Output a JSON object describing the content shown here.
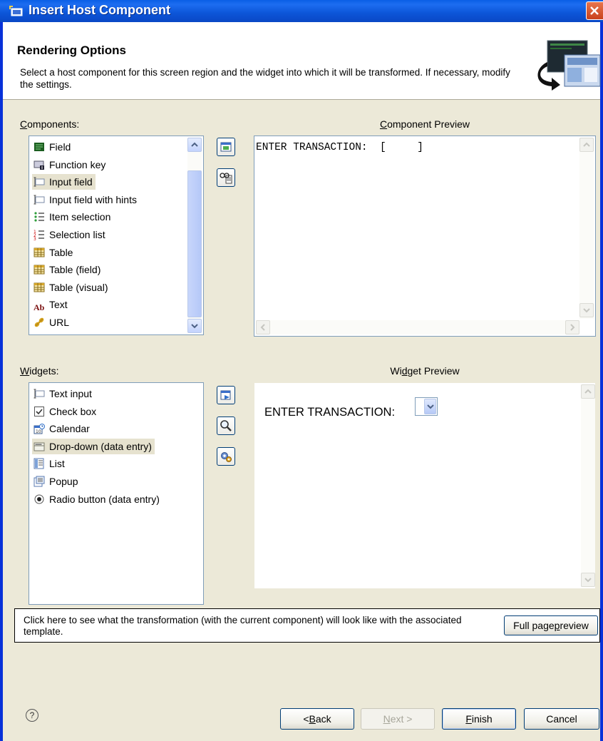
{
  "window": {
    "title": "Insert Host Component",
    "title_icon": "host-component-icon"
  },
  "header": {
    "title": "Rendering Options",
    "description": "Select a host component for this screen region and the widget into which it will be transformed.  If necessary, modify the settings."
  },
  "components": {
    "label_key": "C",
    "label_rest": "omponents:",
    "items": [
      {
        "label": "Field",
        "icon": "field-icon"
      },
      {
        "label": "Function key",
        "icon": "function-key-icon"
      },
      {
        "label": "Input field",
        "icon": "input-field-icon",
        "selected": true
      },
      {
        "label": "Input field with hints",
        "icon": "input-field-hints-icon"
      },
      {
        "label": "Item selection",
        "icon": "item-selection-icon"
      },
      {
        "label": "Selection list",
        "icon": "selection-list-icon"
      },
      {
        "label": "Table",
        "icon": "table-icon"
      },
      {
        "label": "Table (field)",
        "icon": "table-field-icon"
      },
      {
        "label": "Table (visual)",
        "icon": "table-visual-icon"
      },
      {
        "label": "Text",
        "icon": "text-icon"
      },
      {
        "label": "URL",
        "icon": "url-icon"
      }
    ]
  },
  "component_preview": {
    "label_key": "C",
    "label_rest": "omponent Preview",
    "content": "ENTER TRANSACTION:  [     ]"
  },
  "widgets": {
    "label_key": "W",
    "label_rest": "idgets:",
    "items": [
      {
        "label": "Text input",
        "icon": "text-input-icon"
      },
      {
        "label": "Check box",
        "icon": "check-box-icon"
      },
      {
        "label": "Calendar",
        "icon": "calendar-icon"
      },
      {
        "label": "Drop-down (data entry)",
        "icon": "drop-down-icon",
        "selected": true
      },
      {
        "label": "List",
        "icon": "list-icon"
      },
      {
        "label": "Popup",
        "icon": "popup-icon"
      },
      {
        "label": "Radio button (data entry)",
        "icon": "radio-button-icon"
      }
    ]
  },
  "widget_preview": {
    "label_pre": "Wi",
    "label_key": "d",
    "label_rest": "get Preview",
    "field_label": "ENTER TRANSACTION:"
  },
  "info": {
    "text": "Click here to see what the transformation (with the current component) will look like with the associated template.",
    "button_pre": "Full page ",
    "button_key": "p",
    "button_rest": "review"
  },
  "footer": {
    "help": "?",
    "back_pre": "< ",
    "back_key": "B",
    "back_rest": "ack",
    "next_key": "N",
    "next_rest": "ext >",
    "finish_key": "F",
    "finish_rest": "inish",
    "cancel": "Cancel"
  }
}
